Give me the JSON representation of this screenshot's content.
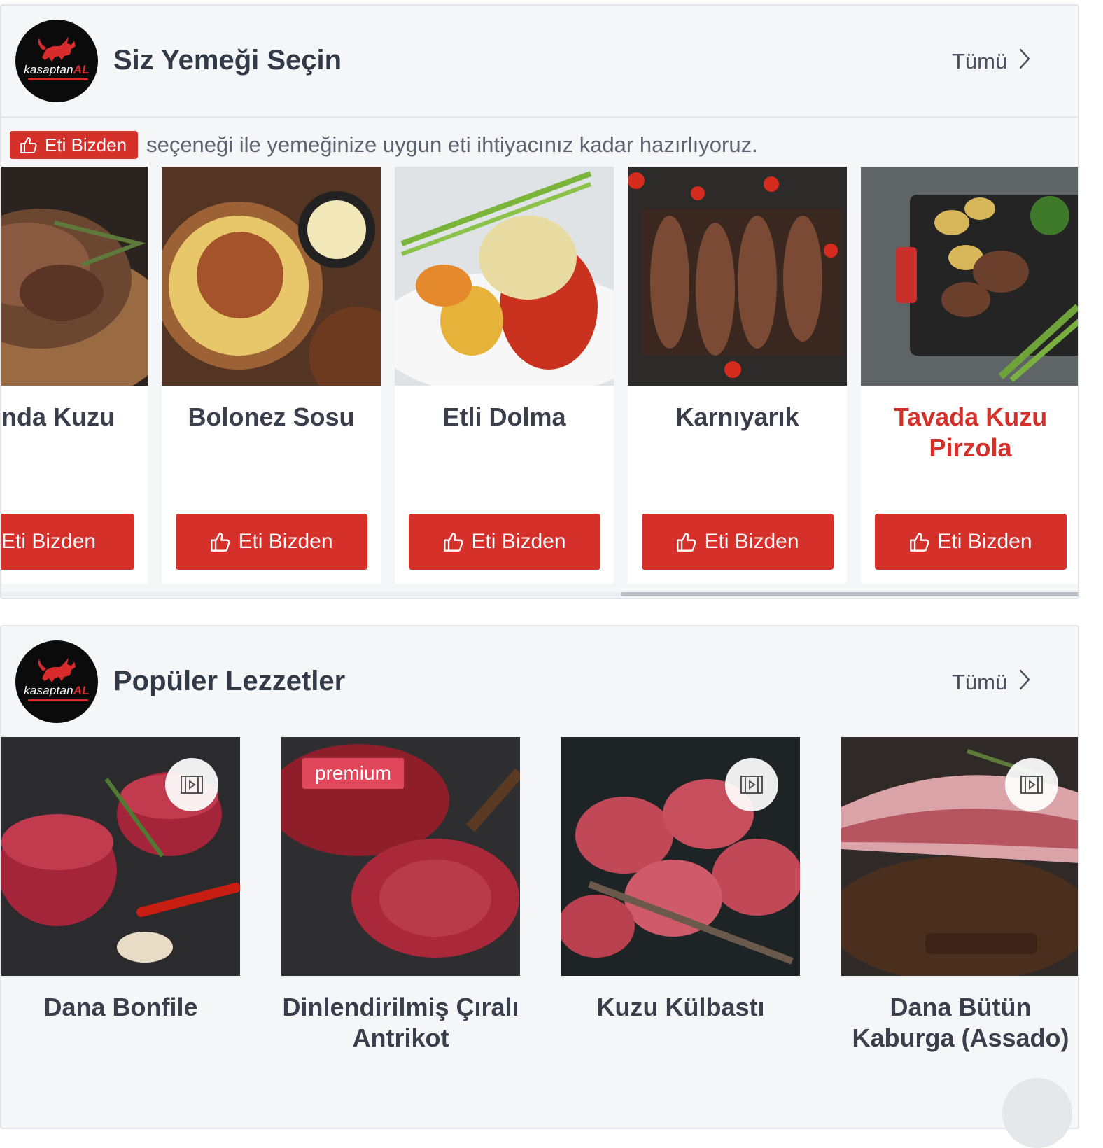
{
  "brand": {
    "logo_text_main": "kasaptan",
    "logo_text_accent": "AL",
    "accent_color": "#d5302a"
  },
  "section_recipes": {
    "title": "Siz Yemeği Seçin",
    "see_all": "Tümü",
    "info_badge": "Eti Bizden",
    "info_text": "seçeneği ile yemeğinize uygun eti ihtiyacınız kadar hazırlıyoruz.",
    "items": [
      {
        "name": "nda Kuzu",
        "button": "Eti Bizden"
      },
      {
        "name": "Bolonez Sosu",
        "button": "Eti Bizden"
      },
      {
        "name": "Etli Dolma",
        "button": "Eti Bizden"
      },
      {
        "name": "Karnıyarık",
        "button": "Eti Bizden"
      },
      {
        "name": "Tavada Kuzu Pirzola",
        "button": "Eti Bizden"
      }
    ]
  },
  "section_products": {
    "title": "Popüler Lezzetler",
    "see_all": "Tümü",
    "items": [
      {
        "name": "Dana Bonfile",
        "has_video": true
      },
      {
        "name": "Dinlendirilmiş Çıralı Antrikot",
        "badge": "premium"
      },
      {
        "name": "Kuzu Külbastı",
        "has_video": true
      },
      {
        "name": "Dana Bütün Kaburga (Assado)",
        "has_video": true
      }
    ]
  }
}
